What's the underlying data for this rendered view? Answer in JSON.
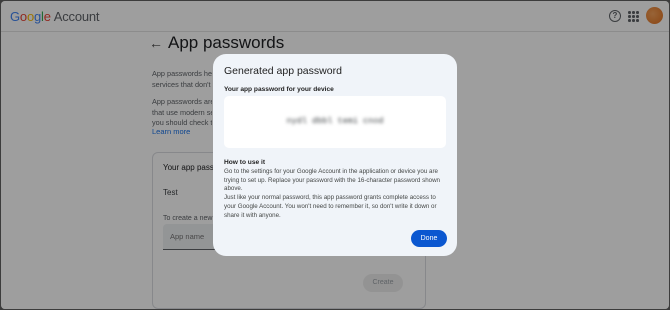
{
  "header": {
    "logo_google": "Google",
    "logo_account": "Account",
    "help_glyph": "?"
  },
  "page": {
    "back_glyph": "←",
    "title": "App passwords",
    "para1_line1": "App passwords help",
    "para1_line2": "services that don't",
    "para2_line1": "App passwords are",
    "para2_line2": "that use modern se",
    "para2_line3": "you should check t",
    "learn_more": "Learn more"
  },
  "card": {
    "title": "Your app passw",
    "existing_app": "Test",
    "create_label": "To create a new a",
    "input_placeholder": "App name",
    "create_button": "Create"
  },
  "dialog": {
    "title": "Generated app password",
    "subtitle": "Your app password for your device",
    "password": "nydl dbbl temi cnod",
    "how_heading": "How to use it",
    "how_p1": "Go to the settings for your Google Account in the application or device you are trying to set up. Replace your password with the 16-character password shown above.",
    "how_p2": "Just like your normal password, this app password grants complete access to your Google Account. You won't need to remember it, so don't write it down or share it with anyone.",
    "done_button": "Done"
  },
  "colors": {
    "accent": "#0b57d0",
    "link": "#1a73e8",
    "dialog_bg": "#f0f4f9"
  },
  "icons": [
    "help-icon",
    "apps-grid-icon",
    "back-arrow-icon"
  ]
}
